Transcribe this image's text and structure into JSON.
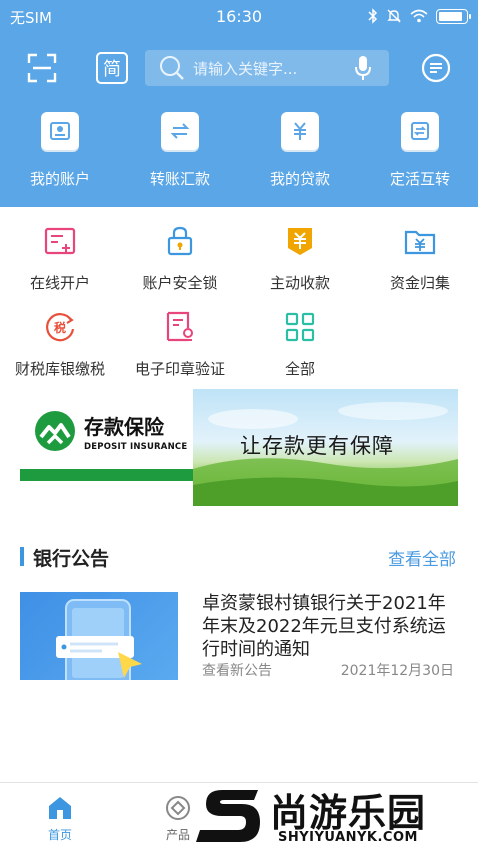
{
  "status_bar": {
    "carrier": "无SIM",
    "time": "16:30",
    "battery_level": 0.9
  },
  "header": {
    "simplified_label": "简",
    "search_placeholder": "请输入关键字...",
    "icons": [
      "scan-icon",
      "search-icon",
      "microphone-icon",
      "message-icon"
    ]
  },
  "quick_actions": [
    {
      "label": "我的账户",
      "icon": "account-icon"
    },
    {
      "label": "转账汇款",
      "icon": "transfer-icon"
    },
    {
      "label": "我的贷款",
      "icon": "loan-icon"
    },
    {
      "label": "定活互转",
      "icon": "deposit-exchange-icon"
    }
  ],
  "services": [
    {
      "label": "在线开户",
      "icon": "open-account-icon",
      "color": "#e8457a"
    },
    {
      "label": "账户安全锁",
      "icon": "security-lock-icon",
      "color": "#3d97e0"
    },
    {
      "label": "主动收款",
      "icon": "collect-payment-icon",
      "color": "#f0a500"
    },
    {
      "label": "资金归集",
      "icon": "fund-folder-icon",
      "color": "#3d97e0"
    },
    {
      "label": "财税库银缴税",
      "icon": "tax-icon",
      "color": "#e8503a"
    },
    {
      "label": "电子印章验证",
      "icon": "e-seal-icon",
      "color": "#e8457a"
    },
    {
      "label": "全部",
      "icon": "all-grid-icon",
      "color": "#2bbfa6"
    }
  ],
  "banner": {
    "title": "存款保险",
    "subtitle": "DEPOSIT INSURANCE",
    "slogan": "让存款更有保障"
  },
  "announcements": {
    "title": "银行公告",
    "view_all": "查看全部",
    "items": [
      {
        "title": "卓资蒙银村镇银行关于2021年年末及2022年元旦支付系统运行时间的通知",
        "subtitle": "查看新公告",
        "date": "2021年12月30日"
      }
    ]
  },
  "tabbar": {
    "tabs": [
      {
        "label": "首页",
        "icon": "home-icon",
        "active": true
      },
      {
        "label": "产品",
        "icon": "product-icon",
        "active": false
      }
    ]
  },
  "watermark": {
    "text": "尚游乐园",
    "url": "SHYIYUANYK.COM"
  },
  "colors": {
    "header_blue": "#5aa6e6",
    "accent": "#3d97e0"
  }
}
